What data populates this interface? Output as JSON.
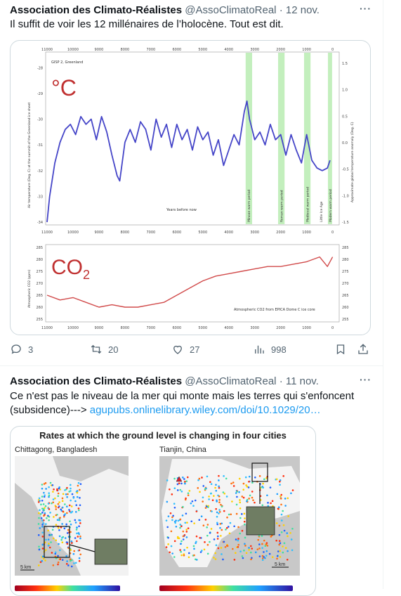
{
  "tweets": [
    {
      "author": "Association des Climato-Réalistes",
      "handle": "@AssoClimatoReal",
      "date": "12 nov.",
      "text": "Il suffit de voir les 12 millénaires de l’holocène. Tout est dit.",
      "chart": {
        "top_axis_ticks": [
          "11000",
          "10000",
          "9000",
          "8000",
          "7000",
          "6000",
          "5000",
          "4000",
          "3000",
          "2000",
          "1000",
          "0"
        ],
        "source_label": "GISP 2, Greenland",
        "temp_symbol": "°C",
        "co2_symbol": "CO",
        "co2_sub": "2",
        "temp_left_ticks": [
          "-28",
          "-29",
          "-30",
          "-31",
          "-32",
          "-33",
          "-34"
        ],
        "temp_right_ticks": [
          "1.5",
          "1.0",
          "0.5",
          "0.0",
          "-0.5",
          "-1.0",
          "-1.5"
        ],
        "co2_ticks": [
          "285",
          "280",
          "275",
          "270",
          "265",
          "260",
          "255"
        ],
        "xlabel": "Years before now",
        "left_axis_label": "Air temperature (Deg. C) at the summit of the Greenland ice sheet",
        "right_axis_label": "Approximate global temperature anomaly (Deg. C)",
        "co2_axis_label": "Atmospheric CO2 (ppm)",
        "co2_source": "Atmospheric CO2 from EPICA Dome C ice core",
        "periods": [
          "Minoan warm period",
          "Roman warm period",
          "Medieval warm period",
          "Little Ice Age",
          "Modern warm period"
        ]
      },
      "stats": {
        "replies": "3",
        "retweets": "20",
        "likes": "27",
        "views": "998"
      }
    },
    {
      "author": "Association des Climato-Réalistes",
      "handle": "@AssoClimatoReal",
      "date": "11 nov.",
      "text": "Ce n'est pas le niveau de la mer qui monte mais les terres qui s'enfoncent (subsidence)---> ",
      "link": "agupubs.onlinelibrary.wiley.com/doi/10.1029/20…",
      "map": {
        "title": "Rates at which the ground level is changing in four cities",
        "city_left": "Chittagong, Bangladesh",
        "city_right": "Tianjin, China",
        "scale": "5 km"
      }
    }
  ],
  "chart_data": [
    {
      "type": "line",
      "title": "",
      "xlabel": "Years before now",
      "ylabel": "Air temperature (Deg. C) at the summit of the Greenland ice sheet",
      "xlim": [
        11000,
        -200
      ],
      "ylim": [
        -34,
        -27.5
      ],
      "series": [
        {
          "name": "GISP 2, Greenland",
          "x": [
            11000,
            10900,
            10700,
            10500,
            10300,
            10100,
            9900,
            9700,
            9500,
            9300,
            9100,
            8900,
            8700,
            8500,
            8300,
            8200,
            8000,
            7800,
            7600,
            7400,
            7200,
            7000,
            6800,
            6600,
            6400,
            6200,
            6000,
            5800,
            5600,
            5400,
            5200,
            5000,
            4800,
            4600,
            4400,
            4200,
            4000,
            3800,
            3600,
            3400,
            3300,
            3200,
            3000,
            2800,
            2600,
            2400,
            2200,
            2000,
            1800,
            1600,
            1400,
            1200,
            1000,
            800,
            600,
            400,
            200,
            100
          ],
          "y": [
            -34,
            -33,
            -31.7,
            -30.9,
            -30.4,
            -30.2,
            -30.6,
            -29.9,
            -30.2,
            -30.0,
            -30.8,
            -29.9,
            -30.5,
            -31.4,
            -32.2,
            -32.4,
            -30.9,
            -30.4,
            -30.9,
            -30.1,
            -30.4,
            -31.2,
            -30.0,
            -30.7,
            -30.2,
            -31.1,
            -30.2,
            -30.8,
            -30.4,
            -31.2,
            -30.3,
            -30.8,
            -30.5,
            -31.4,
            -30.8,
            -31.8,
            -31.2,
            -30.6,
            -31.0,
            -29.7,
            -29.3,
            -30.0,
            -30.8,
            -30.5,
            -31.0,
            -30.2,
            -30.8,
            -30.6,
            -31.4,
            -30.6,
            -31.2,
            -31.7,
            -30.6,
            -31.6,
            -31.9,
            -32.0,
            -31.9,
            -31.6
          ]
        }
      ]
    },
    {
      "type": "line",
      "title": "",
      "xlabel": "",
      "ylabel": "Atmospheric CO2 (ppm)",
      "xlim": [
        11000,
        -200
      ],
      "ylim": [
        255,
        285
      ],
      "series": [
        {
          "name": "Atmospheric CO2 from EPICA Dome C ice core",
          "x": [
            11000,
            10500,
            10000,
            9500,
            9000,
            8500,
            8000,
            7500,
            7000,
            6500,
            6000,
            5500,
            5000,
            4500,
            4000,
            3500,
            3000,
            2500,
            2000,
            1500,
            1000,
            500,
            200,
            0
          ],
          "y": [
            265,
            263,
            264,
            262,
            260,
            261,
            260,
            260,
            261,
            262,
            265,
            268,
            271,
            273,
            274,
            275,
            276,
            277,
            277,
            278,
            279,
            281,
            277,
            281
          ]
        }
      ]
    }
  ]
}
